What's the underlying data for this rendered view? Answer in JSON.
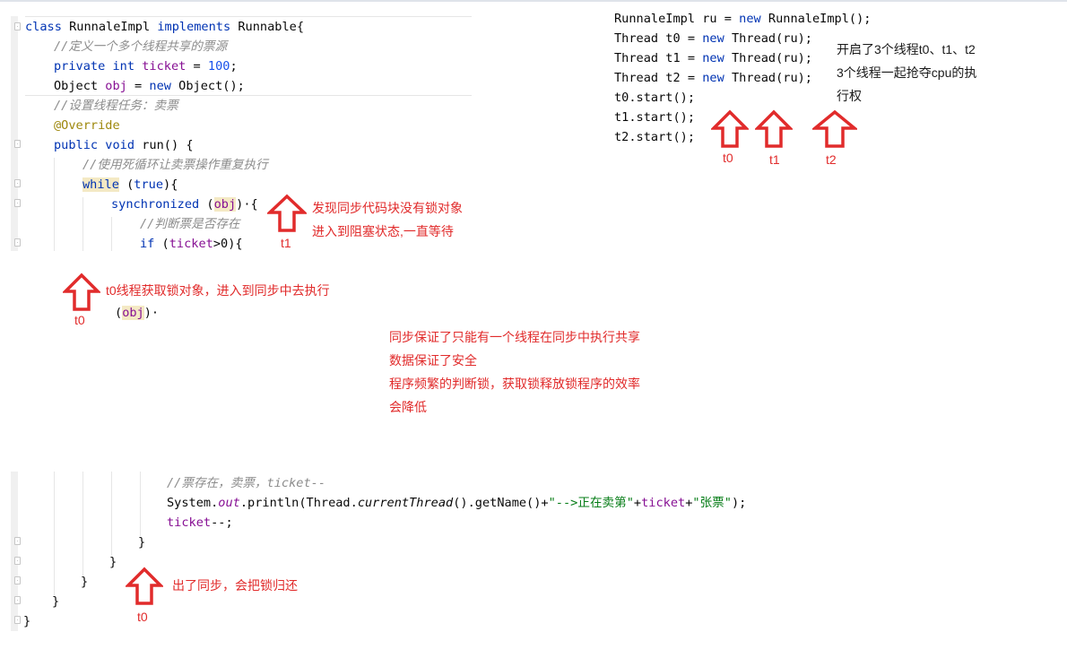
{
  "colors": {
    "keyword": "#0033b3",
    "comment": "#8c8c8c",
    "field": "#871094",
    "number": "#1750eb",
    "annotation": "#9e880d",
    "string": "#067d17",
    "highlight": "#f4e9c4",
    "arrow": "#e12b2b",
    "note_red": "#e12b2b"
  },
  "code_top": {
    "line1": {
      "kw1": "class",
      "name": " RunnaleImpl ",
      "kw2": "implements",
      "rest": " Runnable{"
    },
    "line2": {
      "comment": "//定义一个多个线程共享的票源"
    },
    "line3": {
      "kw": "private int",
      "sp": " ",
      "field": "ticket",
      "eq": " = ",
      "num": "100",
      "end": ";"
    },
    "line4": {
      "a": "Object ",
      "field": "obj",
      "b": " = ",
      "kw": "new",
      "c": " Object();"
    },
    "line5": {
      "comment": "//设置线程任务：卖票"
    },
    "line6": {
      "anno": "@Override"
    },
    "line7": {
      "kw": "public void",
      "rest": " run() {"
    },
    "line8": {
      "comment": "//使用死循环让卖票操作重复执行"
    },
    "line9": {
      "kw1": "while",
      "sp": " (",
      "kw2": "true",
      "rest": "){"
    },
    "line10": {
      "kw": "synchronized",
      "p1": " (",
      "field": "obj",
      "p2": ")·{"
    },
    "line11": {
      "comment": "//判断票是否存在"
    },
    "line12": {
      "kw": "if",
      "p1": " (",
      "field": "ticket",
      "p2": ">0){"
    }
  },
  "code_right": {
    "l1": {
      "a": "RunnaleImpl ru = ",
      "kw": "new",
      "b": " RunnaleImpl();"
    },
    "l2": {
      "a": "Thread t0 = ",
      "kw": "new",
      "b": " Thread(ru);"
    },
    "l3": {
      "a": "Thread t1 = ",
      "kw": "new",
      "b": " Thread(ru);"
    },
    "l4": {
      "a": "Thread t2 = ",
      "kw": "new",
      "b": " Thread(ru);"
    },
    "l5": "t0.start();",
    "l6": "t1.start();",
    "l7": "t2.start();"
  },
  "code_bottom": {
    "b1": {
      "comment": "//票存在，卖票，",
      "it": "ticket--"
    },
    "b2": {
      "a": "System.",
      "out": "out",
      "b": ".println(Thread.",
      "cur": "currentThread",
      "c": "().getName()+",
      "s1": "\"-->正在卖第\"",
      "d": "+",
      "field": "ticket",
      "e": "+",
      "s2": "\"张票\"",
      "f": ");"
    },
    "b3": {
      "field": "ticket",
      "rest": "--;"
    },
    "b4": "}",
    "b5": "}",
    "b6": "}",
    "b7": "}",
    "b8": "}"
  },
  "notes": {
    "threads_started": "开启了3个线程t0、t1、t2\n3个线程一起抢夺cpu的执\n行权",
    "t1_blocked": "发现同步代码块没有锁对象\n进入到阻塞状态,一直等待",
    "t0_acquire": "t0线程获取锁对象，进入到同步中去执行",
    "obj_snippet_open": "(",
    "obj_snippet_field": "obj",
    "obj_snippet_close": ")·",
    "sync_summary": "同步保证了只能有一个线程在同步中执行共享\n数据保证了安全\n程序频繁的判断锁，获取锁释放锁程序的效率\n会降低",
    "release": "出了同步，会把锁归还"
  },
  "arrow_labels": {
    "t0_right": "t0",
    "t1_right": "t1",
    "t2_right": "t2",
    "t1_sync": "t1",
    "t0_sync": "t0",
    "t0_exit": "t0"
  }
}
